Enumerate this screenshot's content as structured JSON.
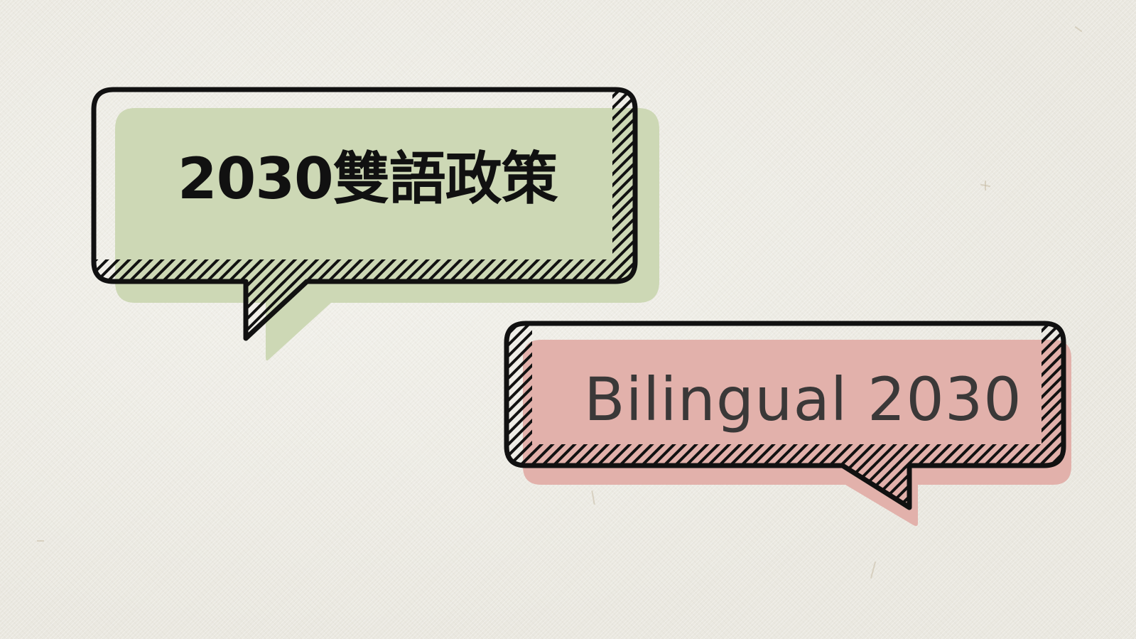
{
  "bubbles": [
    {
      "id": "top-left",
      "text": "2030雙語政策",
      "fill_color": "#cdd8b5",
      "outline_color": "#111111"
    },
    {
      "id": "bottom-right",
      "text": "Bilingual 2030",
      "fill_color": "#e2b1ab",
      "outline_color": "#111111"
    }
  ],
  "background": {
    "color": "#ecebe4",
    "texture": "paper"
  }
}
